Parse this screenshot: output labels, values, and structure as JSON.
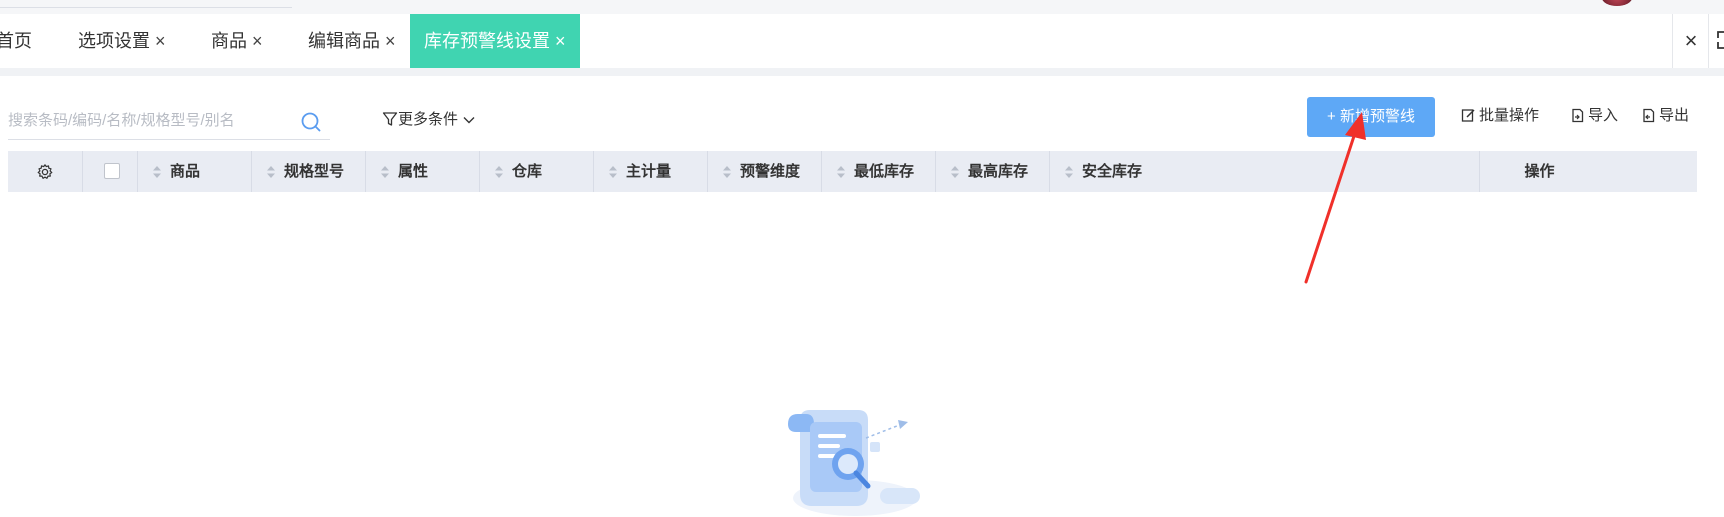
{
  "tabs": [
    {
      "label": "首页",
      "closable": false,
      "active": false
    },
    {
      "label": "选项设置",
      "closable": true,
      "active": false
    },
    {
      "label": "商品",
      "closable": true,
      "active": false
    },
    {
      "label": "编辑商品",
      "closable": true,
      "active": false
    },
    {
      "label": "库存预警线设置",
      "closable": true,
      "active": true
    }
  ],
  "tab_close_glyph": "×",
  "close_all_glyph": "×",
  "search": {
    "placeholder": "搜索条码/编码/名称/规格型号/别名",
    "value": ""
  },
  "more_conditions": "更多条件",
  "toolbar": {
    "add_label": "+ 新增预警线",
    "batch_label": "批量操作",
    "import_label": "导入",
    "export_label": "导出"
  },
  "table": {
    "columns": [
      "商品",
      "规格型号",
      "属性",
      "仓库",
      "主计量",
      "预警维度",
      "最低库存",
      "最高库存",
      "安全库存"
    ],
    "action_column": "操作",
    "rows": []
  },
  "colors": {
    "active_tab": "#40d4b1",
    "primary_button": "#5ea8f6",
    "table_header": "#e9ecf3",
    "annotation_arrow": "#f0302a"
  },
  "icons": {
    "settings": "gear-icon",
    "search": "search-icon",
    "filter": "filter-icon",
    "edit": "edit-icon",
    "import": "import-icon",
    "export": "export-icon"
  }
}
